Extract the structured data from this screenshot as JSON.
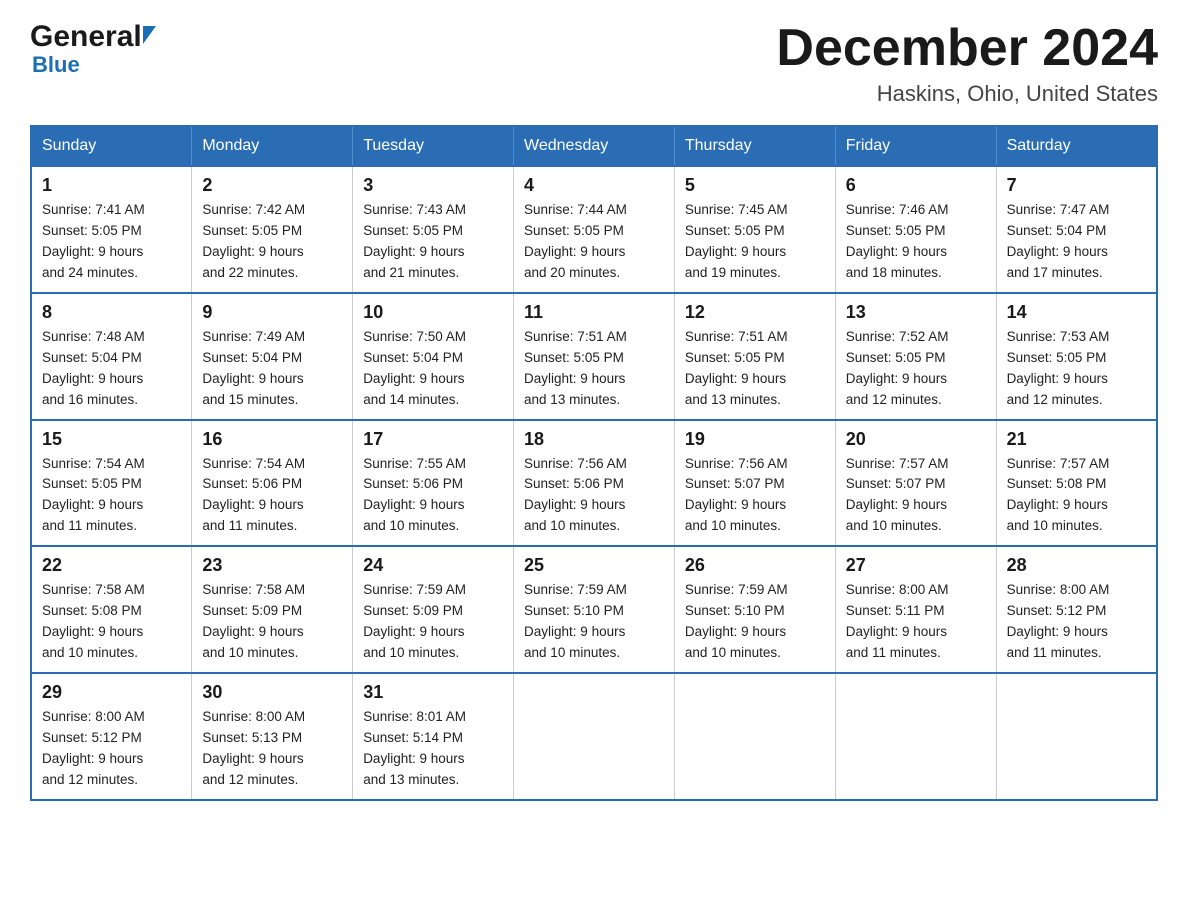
{
  "header": {
    "logo_general": "General",
    "logo_blue": "Blue",
    "title": "December 2024",
    "subtitle": "Haskins, Ohio, United States"
  },
  "days_of_week": [
    "Sunday",
    "Monday",
    "Tuesday",
    "Wednesday",
    "Thursday",
    "Friday",
    "Saturday"
  ],
  "weeks": [
    [
      {
        "day": "1",
        "sunrise": "7:41 AM",
        "sunset": "5:05 PM",
        "daylight": "9 hours and 24 minutes."
      },
      {
        "day": "2",
        "sunrise": "7:42 AM",
        "sunset": "5:05 PM",
        "daylight": "9 hours and 22 minutes."
      },
      {
        "day": "3",
        "sunrise": "7:43 AM",
        "sunset": "5:05 PM",
        "daylight": "9 hours and 21 minutes."
      },
      {
        "day": "4",
        "sunrise": "7:44 AM",
        "sunset": "5:05 PM",
        "daylight": "9 hours and 20 minutes."
      },
      {
        "day": "5",
        "sunrise": "7:45 AM",
        "sunset": "5:05 PM",
        "daylight": "9 hours and 19 minutes."
      },
      {
        "day": "6",
        "sunrise": "7:46 AM",
        "sunset": "5:05 PM",
        "daylight": "9 hours and 18 minutes."
      },
      {
        "day": "7",
        "sunrise": "7:47 AM",
        "sunset": "5:04 PM",
        "daylight": "9 hours and 17 minutes."
      }
    ],
    [
      {
        "day": "8",
        "sunrise": "7:48 AM",
        "sunset": "5:04 PM",
        "daylight": "9 hours and 16 minutes."
      },
      {
        "day": "9",
        "sunrise": "7:49 AM",
        "sunset": "5:04 PM",
        "daylight": "9 hours and 15 minutes."
      },
      {
        "day": "10",
        "sunrise": "7:50 AM",
        "sunset": "5:04 PM",
        "daylight": "9 hours and 14 minutes."
      },
      {
        "day": "11",
        "sunrise": "7:51 AM",
        "sunset": "5:05 PM",
        "daylight": "9 hours and 13 minutes."
      },
      {
        "day": "12",
        "sunrise": "7:51 AM",
        "sunset": "5:05 PM",
        "daylight": "9 hours and 13 minutes."
      },
      {
        "day": "13",
        "sunrise": "7:52 AM",
        "sunset": "5:05 PM",
        "daylight": "9 hours and 12 minutes."
      },
      {
        "day": "14",
        "sunrise": "7:53 AM",
        "sunset": "5:05 PM",
        "daylight": "9 hours and 12 minutes."
      }
    ],
    [
      {
        "day": "15",
        "sunrise": "7:54 AM",
        "sunset": "5:05 PM",
        "daylight": "9 hours and 11 minutes."
      },
      {
        "day": "16",
        "sunrise": "7:54 AM",
        "sunset": "5:06 PM",
        "daylight": "9 hours and 11 minutes."
      },
      {
        "day": "17",
        "sunrise": "7:55 AM",
        "sunset": "5:06 PM",
        "daylight": "9 hours and 10 minutes."
      },
      {
        "day": "18",
        "sunrise": "7:56 AM",
        "sunset": "5:06 PM",
        "daylight": "9 hours and 10 minutes."
      },
      {
        "day": "19",
        "sunrise": "7:56 AM",
        "sunset": "5:07 PM",
        "daylight": "9 hours and 10 minutes."
      },
      {
        "day": "20",
        "sunrise": "7:57 AM",
        "sunset": "5:07 PM",
        "daylight": "9 hours and 10 minutes."
      },
      {
        "day": "21",
        "sunrise": "7:57 AM",
        "sunset": "5:08 PM",
        "daylight": "9 hours and 10 minutes."
      }
    ],
    [
      {
        "day": "22",
        "sunrise": "7:58 AM",
        "sunset": "5:08 PM",
        "daylight": "9 hours and 10 minutes."
      },
      {
        "day": "23",
        "sunrise": "7:58 AM",
        "sunset": "5:09 PM",
        "daylight": "9 hours and 10 minutes."
      },
      {
        "day": "24",
        "sunrise": "7:59 AM",
        "sunset": "5:09 PM",
        "daylight": "9 hours and 10 minutes."
      },
      {
        "day": "25",
        "sunrise": "7:59 AM",
        "sunset": "5:10 PM",
        "daylight": "9 hours and 10 minutes."
      },
      {
        "day": "26",
        "sunrise": "7:59 AM",
        "sunset": "5:10 PM",
        "daylight": "9 hours and 10 minutes."
      },
      {
        "day": "27",
        "sunrise": "8:00 AM",
        "sunset": "5:11 PM",
        "daylight": "9 hours and 11 minutes."
      },
      {
        "day": "28",
        "sunrise": "8:00 AM",
        "sunset": "5:12 PM",
        "daylight": "9 hours and 11 minutes."
      }
    ],
    [
      {
        "day": "29",
        "sunrise": "8:00 AM",
        "sunset": "5:12 PM",
        "daylight": "9 hours and 12 minutes."
      },
      {
        "day": "30",
        "sunrise": "8:00 AM",
        "sunset": "5:13 PM",
        "daylight": "9 hours and 12 minutes."
      },
      {
        "day": "31",
        "sunrise": "8:01 AM",
        "sunset": "5:14 PM",
        "daylight": "9 hours and 13 minutes."
      },
      null,
      null,
      null,
      null
    ]
  ],
  "labels": {
    "sunrise": "Sunrise:",
    "sunset": "Sunset:",
    "daylight": "Daylight:"
  }
}
